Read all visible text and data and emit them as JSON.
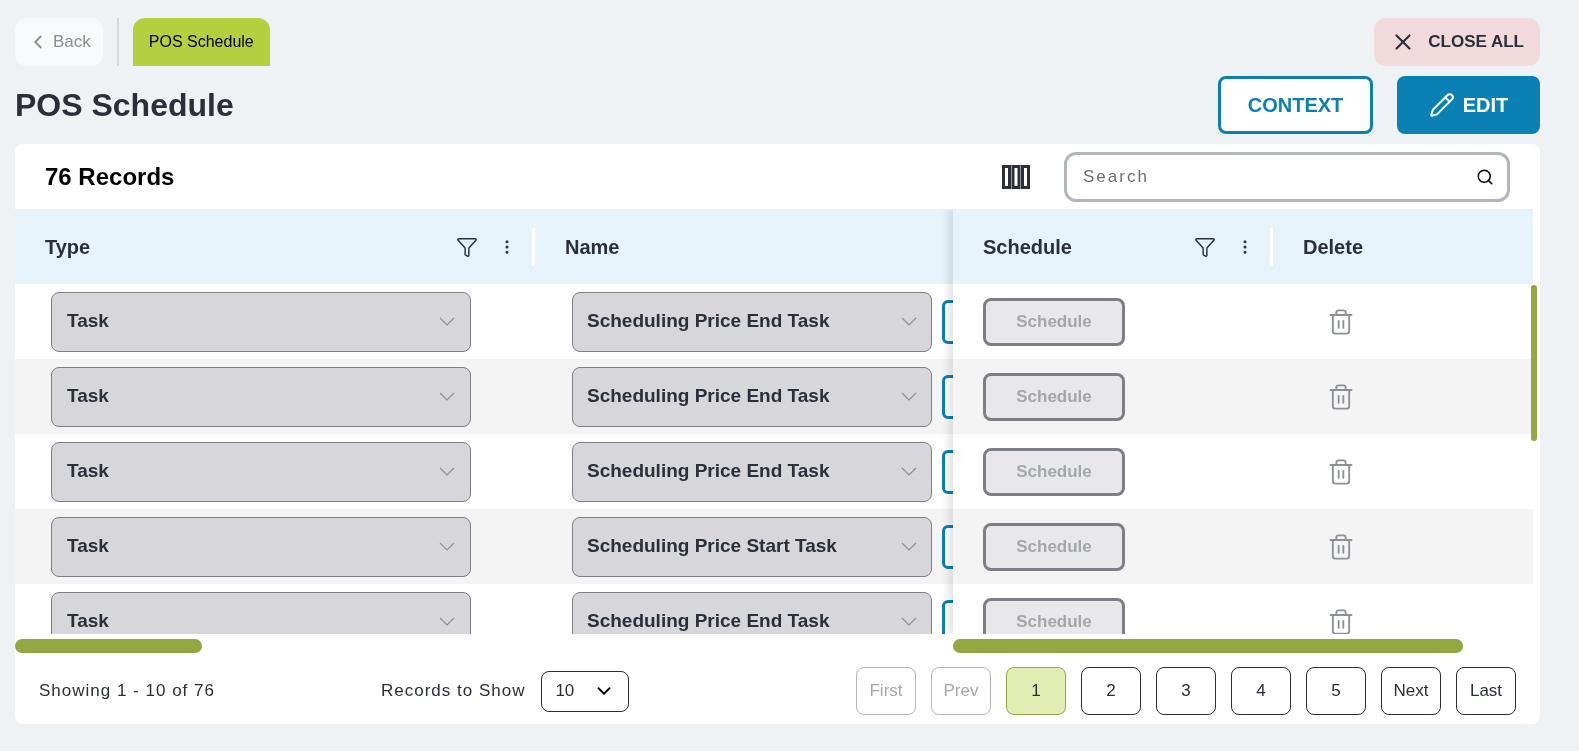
{
  "nav": {
    "back": "Back",
    "tab": {
      "label": "POS Schedule",
      "selected": true
    },
    "close_all": "CLOSE ALL"
  },
  "title": "POS Schedule",
  "actions": {
    "context": "CONTEXT",
    "edit": "EDIT"
  },
  "table": {
    "record_count": "76 Records",
    "search": {
      "placeholder": "Search"
    },
    "columns": [
      {
        "label": "Type",
        "filter": true
      },
      {
        "label": "Name",
        "filter": false
      },
      {
        "label": "Schedule",
        "filter": true
      },
      {
        "label": "Delete",
        "filter": false
      }
    ],
    "rows": [
      {
        "type": "Task",
        "name": "Scheduling Price End Task",
        "schedule": "Schedule",
        "schedule_disabled": true
      },
      {
        "type": "Task",
        "name": "Scheduling Price End Task",
        "schedule": "Schedule",
        "schedule_disabled": true
      },
      {
        "type": "Task",
        "name": "Scheduling Price End Task",
        "schedule": "Schedule",
        "schedule_disabled": true
      },
      {
        "type": "Task",
        "name": "Scheduling Price Start Task",
        "schedule": "Schedule",
        "schedule_disabled": true
      },
      {
        "type": "Task",
        "name": "Scheduling Price End Task",
        "schedule": "Schedule",
        "schedule_disabled": true
      }
    ]
  },
  "footer": {
    "showing": "Showing 1 - 10 of 76",
    "records_label": "Records to Show",
    "records_value": "10",
    "pages": [
      {
        "label": "First",
        "disabled": true,
        "selected": false
      },
      {
        "label": "Prev",
        "disabled": true,
        "selected": false
      },
      {
        "label": "1",
        "disabled": false,
        "selected": true
      },
      {
        "label": "2",
        "disabled": false,
        "selected": false
      },
      {
        "label": "3",
        "disabled": false,
        "selected": false
      },
      {
        "label": "4",
        "disabled": false,
        "selected": false
      },
      {
        "label": "5",
        "disabled": false,
        "selected": false
      },
      {
        "label": "Next",
        "disabled": false,
        "selected": false
      },
      {
        "label": "Last",
        "disabled": false,
        "selected": false
      }
    ]
  }
}
